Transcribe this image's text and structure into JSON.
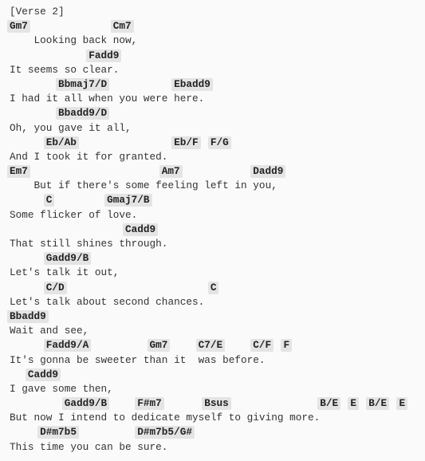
{
  "section_label": "[Verse 2]",
  "lines": [
    {
      "type": "chords",
      "chords": [
        {
          "chord": "Gm7",
          "col": 0
        },
        {
          "chord": "Cm7",
          "col": 17
        }
      ]
    },
    {
      "type": "lyric",
      "text": "    Looking back now,"
    },
    {
      "type": "chords",
      "chords": [
        {
          "chord": "Fadd9",
          "col": 13
        }
      ]
    },
    {
      "type": "lyric",
      "text": "It seems so clear."
    },
    {
      "type": "chords",
      "chords": [
        {
          "chord": "Bbmaj7/D",
          "col": 8
        },
        {
          "chord": "Ebadd9",
          "col": 27
        }
      ]
    },
    {
      "type": "lyric",
      "text": "I had it all when you were here."
    },
    {
      "type": "chords",
      "chords": [
        {
          "chord": "Bbadd9/D",
          "col": 8
        }
      ]
    },
    {
      "type": "lyric",
      "text": "Oh, you gave it all,"
    },
    {
      "type": "chords",
      "chords": [
        {
          "chord": "Eb/Ab",
          "col": 6
        },
        {
          "chord": "Eb/F",
          "col": 27
        },
        {
          "chord": "F/G",
          "col": 33
        }
      ]
    },
    {
      "type": "lyric",
      "text": "And I took it for granted."
    },
    {
      "type": "chords",
      "chords": [
        {
          "chord": "Em7",
          "col": 0
        },
        {
          "chord": "Am7",
          "col": 25
        },
        {
          "chord": "Dadd9",
          "col": 40
        }
      ]
    },
    {
      "type": "lyric",
      "text": "    But if there's some feeling left in you,"
    },
    {
      "type": "chords",
      "chords": [
        {
          "chord": "C",
          "col": 6
        },
        {
          "chord": "Gmaj7/B",
          "col": 16
        }
      ]
    },
    {
      "type": "lyric",
      "text": "Some flicker of love."
    },
    {
      "type": "chords",
      "chords": [
        {
          "chord": "Cadd9",
          "col": 19
        }
      ]
    },
    {
      "type": "lyric",
      "text": "That still shines through."
    },
    {
      "type": "chords",
      "chords": [
        {
          "chord": "Gadd9/B",
          "col": 6
        }
      ]
    },
    {
      "type": "lyric",
      "text": "Let's talk it out,"
    },
    {
      "type": "chords",
      "chords": [
        {
          "chord": "C/D",
          "col": 6
        },
        {
          "chord": "C",
          "col": 33
        }
      ]
    },
    {
      "type": "lyric",
      "text": "Let's talk about second chances."
    },
    {
      "type": "chords",
      "chords": [
        {
          "chord": "Bbadd9",
          "col": 0
        }
      ]
    },
    {
      "type": "lyric",
      "text": "Wait and see,"
    },
    {
      "type": "chords",
      "chords": [
        {
          "chord": "Fadd9/A",
          "col": 6
        },
        {
          "chord": "Gm7",
          "col": 23
        },
        {
          "chord": "C7/E",
          "col": 31
        },
        {
          "chord": "C/F",
          "col": 40
        },
        {
          "chord": "F",
          "col": 45
        }
      ]
    },
    {
      "type": "lyric",
      "text": "It's gonna be sweeter than it  was before."
    },
    {
      "type": "chords",
      "chords": [
        {
          "chord": "Cadd9",
          "col": 3
        }
      ]
    },
    {
      "type": "lyric",
      "text": "I gave some then,"
    },
    {
      "type": "chords",
      "chords": [
        {
          "chord": "Gadd9/B",
          "col": 9
        },
        {
          "chord": "F#m7",
          "col": 21
        },
        {
          "chord": "Bsus",
          "col": 32
        },
        {
          "chord": "B/E",
          "col": 51
        },
        {
          "chord": "E",
          "col": 56
        },
        {
          "chord": "B/E",
          "col": 59
        },
        {
          "chord": "E",
          "col": 64
        }
      ]
    },
    {
      "type": "lyric",
      "text": "But now I intend to dedicate myself to giving more."
    },
    {
      "type": "chords",
      "chords": [
        {
          "chord": "D#m7b5",
          "col": 5
        },
        {
          "chord": "D#m7b5/G#",
          "col": 21
        }
      ]
    },
    {
      "type": "lyric",
      "text": "This time you can be sure."
    }
  ]
}
